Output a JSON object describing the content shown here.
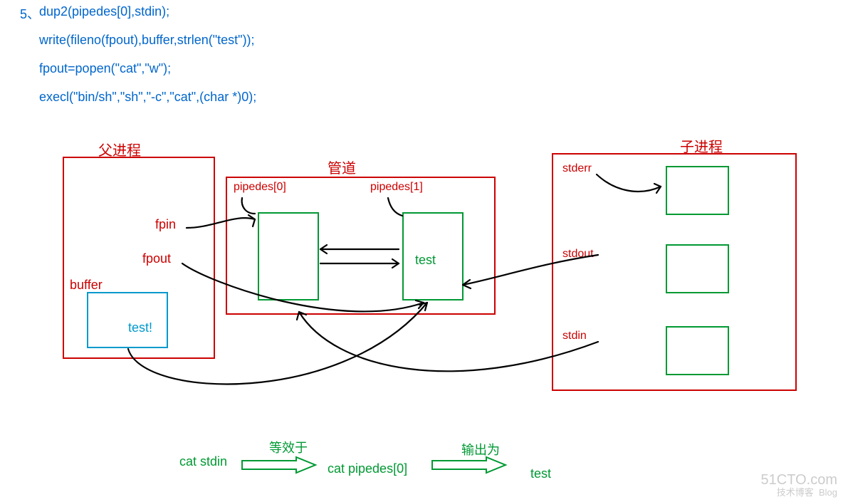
{
  "code": {
    "num": "5、",
    "line1": "dup2(pipedes[0],stdin);",
    "line2": "write(fileno(fpout),buffer,strlen(\"test\"));",
    "line3": "fpout=popen(\"cat\",\"w\");",
    "line4": "execl(\"bin/sh\",\"sh\",\"-c\",\"cat\",(char *)0);"
  },
  "parent": {
    "title": "父进程",
    "fpin": "fpin",
    "fpout": "fpout",
    "buffer": "buffer",
    "bufval": "test!"
  },
  "pipe": {
    "title": "管道",
    "end0": "pipedes[0]",
    "end1": "pipedes[1]",
    "content": "test"
  },
  "child": {
    "title": "子进程",
    "stderr": "stderr",
    "stdout": "stdout",
    "stdin": "stdin"
  },
  "flow": {
    "cat_stdin": "cat stdin",
    "equiv": "等效于",
    "cat_pipe": "cat pipedes[0]",
    "output": "输出为",
    "result": "test"
  },
  "watermark": {
    "site": "51CTO.com",
    "sub": "技术博客",
    "tag": "Blog"
  }
}
